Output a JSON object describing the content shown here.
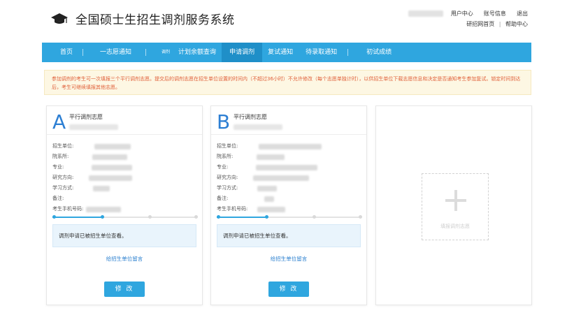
{
  "header": {
    "site_title": "全国硕士生招生调剂服务系统",
    "links_row1": [
      "用户中心",
      "账号信息",
      "退出"
    ],
    "links_row2": [
      "研招网首页",
      "帮助中心"
    ]
  },
  "nav": {
    "items": [
      {
        "label": "首页",
        "active": false
      },
      {
        "label": "一志愿通知",
        "active": false
      },
      {
        "label": "调剂",
        "active": false,
        "small": true
      },
      {
        "label": "计划余额查询",
        "active": false
      },
      {
        "label": "申请调剂",
        "active": true
      },
      {
        "label": "复试通知",
        "active": false
      },
      {
        "label": "待录取通知",
        "active": false
      },
      {
        "label": "初试成绩",
        "active": false
      }
    ]
  },
  "notice": {
    "text": "参加调剂的考生可一次填报三个平行调剂志愿。提交后的调剂志愿在招生单位设置的时间内（不超过36小时）不允许修改（每个志愿单独计时），以供招生单位下载志愿信息和决定是否通知考生参加复试。锁定时间到达后，考生可继续填报其他志愿。"
  },
  "cards": [
    {
      "letter": "A",
      "title": "平行调剂志愿",
      "fields": [
        "招生单位:",
        "院系所:",
        "专业:",
        "研究方向:",
        "学习方式:",
        "备注:",
        "考生手机号码:"
      ],
      "progress_filled_steps": 2,
      "progress_total_steps": 4,
      "status": "调剂申请已被招生单位查看。",
      "message_link": "给招生单位留言",
      "edit_button": "修 改"
    },
    {
      "letter": "B",
      "title": "平行调剂志愿",
      "fields": [
        "招生单位:",
        "院系所:",
        "专业:",
        "研究方向:",
        "学习方式:",
        "备注:",
        "考生手机号码:"
      ],
      "progress_filled_steps": 2,
      "progress_total_steps": 4,
      "status": "调剂申请已被招生单位查看。",
      "message_link": "给招生单位留言",
      "edit_button": "修 改"
    }
  ],
  "add_card": {
    "label": "填报调剂志愿",
    "icon": "plus-icon"
  },
  "colors": {
    "nav_bg": "#2fa6df",
    "nav_active": "#1f8fc8",
    "notice_text": "#e0603a",
    "accent_letter": "#2d7fd3",
    "link": "#2a7fcf"
  }
}
